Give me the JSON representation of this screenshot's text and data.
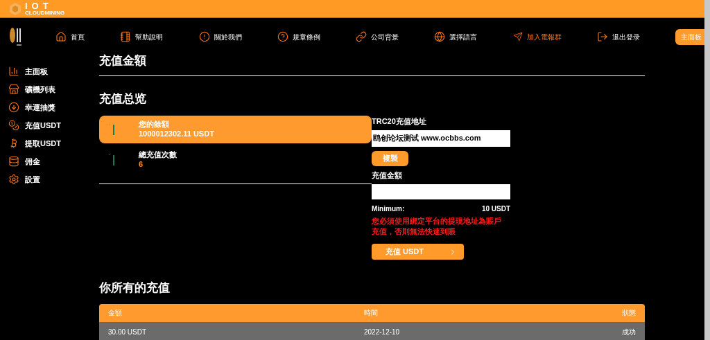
{
  "brand": {
    "name": "IOT",
    "tagline": "CLOUDMINING"
  },
  "nav": [
    {
      "label": "首頁",
      "kind": "link"
    },
    {
      "label": "幫助說明",
      "kind": "link"
    },
    {
      "label": "關於我們",
      "kind": "link"
    },
    {
      "label": "規章條例",
      "kind": "link"
    },
    {
      "label": "公司背景",
      "kind": "link"
    },
    {
      "label": "選擇語言",
      "kind": "link"
    },
    {
      "label": "加入電報群",
      "kind": "highlight"
    },
    {
      "label": "退出登录",
      "kind": "link"
    },
    {
      "label": "主面板",
      "kind": "button"
    }
  ],
  "sidebar": {
    "items": [
      {
        "label": "主面板",
        "selected": false
      },
      {
        "label": "礦機列表",
        "selected": false
      },
      {
        "label": "幸運抽獎",
        "selected": false
      },
      {
        "label": "充值USDT",
        "selected": false
      },
      {
        "label": "提取USDT",
        "selected": false
      },
      {
        "label": "佣金",
        "selected": false
      },
      {
        "label": "設置",
        "selected": false
      }
    ]
  },
  "page_title": "充值金額",
  "overview_title": "充值总览",
  "stats": [
    {
      "label": "您的餘額",
      "value": "1000012302.11 USDT",
      "selected": true
    },
    {
      "label": "總充值次數",
      "value": "6",
      "selected": false
    }
  ],
  "deposit": {
    "address_label": "TRC20充值地址",
    "address_value": "鸥创论坛测试 www.ocbbs.com",
    "copy_button": "複製",
    "amount_label": "充值金額",
    "minimum_label": "Minimum:",
    "minimum_value": "10 USDT",
    "warning": "您必須使用綁定平台的提現地址為賬戶充值，否則無法快速到賬",
    "submit_button": "充值 USDT"
  },
  "history": {
    "title": "你所有的充值",
    "columns": [
      "金額",
      "時間",
      "狀態"
    ],
    "rows": [
      [
        "30.00 USDT",
        "2022-12-10",
        "成功"
      ]
    ]
  }
}
